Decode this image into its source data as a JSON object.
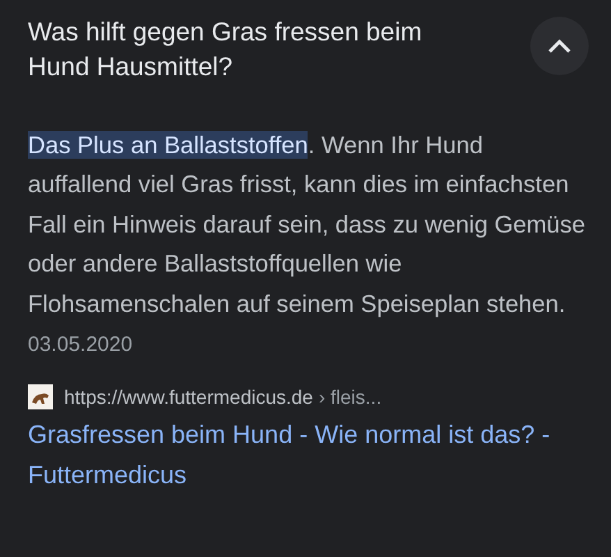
{
  "question": {
    "title": "Was hilft gegen Gras fressen beim Hund Hausmittel?",
    "expanded": true
  },
  "answer": {
    "highlight": "Das Plus an Ballaststoffen",
    "text": ". Wenn Ihr Hund auffallend viel Gras frisst, kann dies im einfachsten Fall ein Hinweis darauf sein, dass zu wenig Gemüse oder andere Ballaststoffquellen wie Flohsamenschalen auf seinem Speiseplan stehen.",
    "date": "03.05.2020"
  },
  "source": {
    "url": "https://www.futtermedicus.de",
    "path": "› fleis...",
    "link": "Grasfressen beim Hund - Wie normal ist das? - Futtermedicus"
  }
}
